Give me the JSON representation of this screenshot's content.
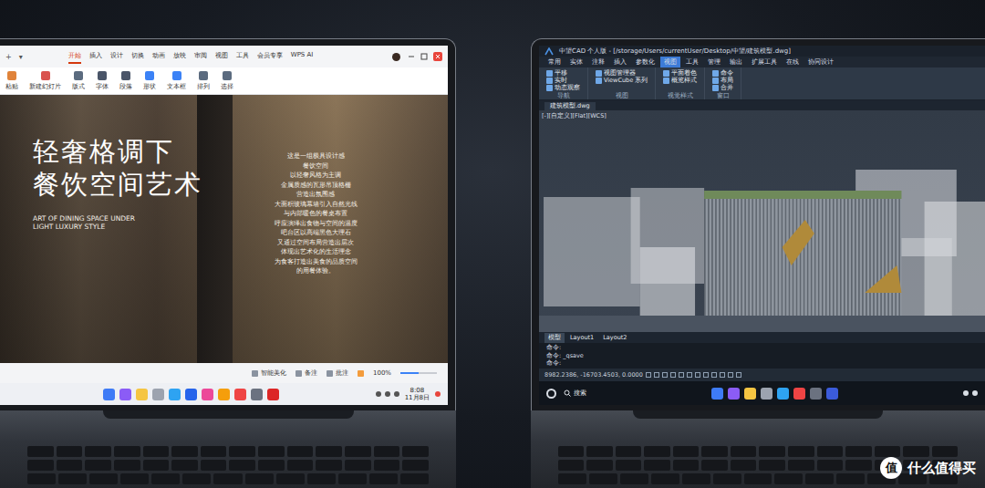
{
  "left_laptop": {
    "app": "WPS",
    "doc_tab_controls": [
      "+",
      "▾"
    ],
    "menu_tabs": [
      {
        "label": "开始",
        "selected": true
      },
      {
        "label": "插入",
        "selected": false
      },
      {
        "label": "设计",
        "selected": false
      },
      {
        "label": "切换",
        "selected": false
      },
      {
        "label": "动画",
        "selected": false
      },
      {
        "label": "放映",
        "selected": false
      },
      {
        "label": "审阅",
        "selected": false
      },
      {
        "label": "视图",
        "selected": false
      },
      {
        "label": "工具",
        "selected": false
      },
      {
        "label": "会员专享",
        "selected": false
      },
      {
        "label": "WPS AI",
        "selected": false
      }
    ],
    "ribbon": [
      {
        "label": "粘贴",
        "color": "#e0833a"
      },
      {
        "label": "新建幻灯片",
        "color": "#d9534f"
      },
      {
        "label": "版式",
        "color": "#5b6b7f"
      },
      {
        "label": "字体",
        "color": "#4a5568"
      },
      {
        "label": "段落",
        "color": "#4a5568"
      },
      {
        "label": "形状",
        "color": "#3b82f6"
      },
      {
        "label": "文本框",
        "color": "#3b82f6"
      },
      {
        "label": "排列",
        "color": "#5b6b7f"
      },
      {
        "label": "选择",
        "color": "#5b6b7f"
      }
    ],
    "slide": {
      "title_lines": [
        "轻奢格调下",
        "餐饮空间艺术"
      ],
      "subtitle_lines": [
        "ART OF DINING SPACE UNDER",
        "LIGHT LUXURY STYLE"
      ],
      "paragraph_lines": [
        "这是一组极具设计感",
        "餐饮空间",
        "以轻奢风格为主调",
        "金属质感的瓦形吊顶格栅",
        "营造出氛围感",
        "大面积玻璃幕墙引入自然光线",
        "与内部暖色的餐桌布置",
        "呼应演绎出食物与空间的温度",
        "吧台区以高端黑色大理石",
        "又通过空间布局营造出层次",
        "体现出艺术化的生活理念",
        "为食客打造出美食的品质空间",
        "的用餐体验。"
      ]
    },
    "status_bar": {
      "items": [
        "智能美化",
        "备注",
        "批注"
      ],
      "zoom": "100%",
      "zoom_level": 0.5
    },
    "taskbar": {
      "dock": [
        {
          "color": "#3e7bf6"
        },
        {
          "color": "#8b5cf6"
        },
        {
          "color": "#f5c542"
        },
        {
          "color": "#9ca3af"
        },
        {
          "color": "#2ea3f2"
        },
        {
          "color": "#2563eb"
        },
        {
          "color": "#ec4899"
        },
        {
          "color": "#f59e0b"
        },
        {
          "color": "#ef4444"
        },
        {
          "color": "#6b7280"
        },
        {
          "color": "#dc2626"
        }
      ],
      "time": "8:08",
      "date": "11月8日"
    }
  },
  "right_laptop": {
    "app": "中望CAD",
    "title": "中望CAD 个人版 - [/storage/Users/currentUser/Desktop/中望/建筑模型.dwg]",
    "menu_tabs": [
      {
        "label": "常用",
        "selected": false
      },
      {
        "label": "实体",
        "selected": false
      },
      {
        "label": "注释",
        "selected": false
      },
      {
        "label": "插入",
        "selected": false
      },
      {
        "label": "参数化",
        "selected": false
      },
      {
        "label": "视图",
        "selected": true
      },
      {
        "label": "工具",
        "selected": false
      },
      {
        "label": "管理",
        "selected": false
      },
      {
        "label": "输出",
        "selected": false
      },
      {
        "label": "扩展工具",
        "selected": false
      },
      {
        "label": "在线",
        "selected": false
      },
      {
        "label": "协同设计",
        "selected": false
      }
    ],
    "ribbon_groups": [
      {
        "label": "导航",
        "buttons": [
          "平移",
          "实时",
          "动态观察"
        ]
      },
      {
        "label": "视图",
        "buttons": [
          "视图管理器",
          "ViewCube 系列"
        ]
      },
      {
        "label": "视觉样式",
        "buttons": [
          "平面着色",
          "概览样式"
        ]
      },
      {
        "label": "窗口",
        "buttons": [
          "命令",
          "布局",
          "合并"
        ]
      }
    ],
    "file_tab": "建筑模型.dwg",
    "viewport_label": "[-][自定义][Flat][WCS]",
    "layout_tabs": [
      {
        "label": "模型",
        "selected": true
      },
      {
        "label": "Layout1",
        "selected": false
      },
      {
        "label": "Layout2",
        "selected": false
      }
    ],
    "command_lines": [
      "命令:",
      "命令: _qsave",
      "命令:"
    ],
    "coordinates": "8982.2386, -16703.4503, 0.0000",
    "taskbar": {
      "search": "搜索",
      "dock": [
        {
          "color": "#3e7bf6"
        },
        {
          "color": "#8b5cf6"
        },
        {
          "color": "#f5c542"
        },
        {
          "color": "#9ca3af"
        },
        {
          "color": "#2ea3f2"
        },
        {
          "color": "#ef4444"
        },
        {
          "color": "#6b7280"
        },
        {
          "color": "#3b5bdb"
        }
      ]
    }
  },
  "watermark": {
    "glyph": "值",
    "text": "什么值得买"
  }
}
